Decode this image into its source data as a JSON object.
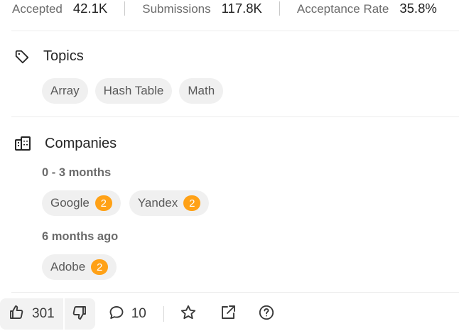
{
  "stats": {
    "accepted_label": "Accepted",
    "accepted_value": "42.1K",
    "submissions_label": "Submissions",
    "submissions_value": "117.8K",
    "acceptance_label": "Acceptance Rate",
    "acceptance_value": "35.8%"
  },
  "topics": {
    "title": "Topics",
    "icon": "tag-icon",
    "tags": [
      "Array",
      "Hash Table",
      "Math"
    ]
  },
  "companies": {
    "title": "Companies",
    "icon": "building-icon",
    "groups": [
      {
        "period": "0 - 3 months",
        "items": [
          {
            "name": "Google",
            "count": "2"
          },
          {
            "name": "Yandex",
            "count": "2"
          }
        ]
      },
      {
        "period": "6 months ago",
        "items": [
          {
            "name": "Adobe",
            "count": "2"
          }
        ]
      }
    ]
  },
  "toolbar": {
    "likes": "301",
    "comments": "10",
    "icons": [
      "thumbs-up-icon",
      "thumbs-down-icon",
      "comment-icon",
      "star-icon",
      "share-icon",
      "help-icon"
    ]
  },
  "colors": {
    "badge": "#ffa116",
    "chip_bg": "#f0f0f0",
    "text": "#262626",
    "muted": "#6b6b6b"
  }
}
